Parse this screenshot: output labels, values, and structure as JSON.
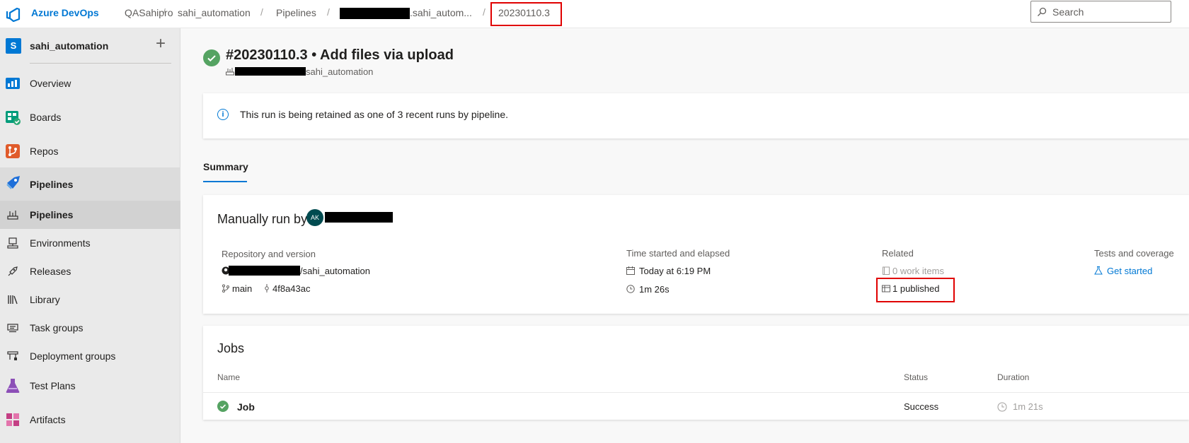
{
  "header": {
    "brand": "Azure DevOps",
    "breadcrumbs": [
      "QASahipro",
      "sahi_automation",
      "Pipelines",
      ".sahi_autom...",
      "20230110.3"
    ],
    "separator": "/",
    "search_placeholder": "Search"
  },
  "sidebar": {
    "project_initial": "S",
    "project_name": "sahi_automation",
    "add_label": "+",
    "items": [
      {
        "label": "Overview",
        "icon": "overview-icon"
      },
      {
        "label": "Boards",
        "icon": "boards-icon"
      },
      {
        "label": "Repos",
        "icon": "repos-icon"
      },
      {
        "label": "Pipelines",
        "icon": "pipelines-icon"
      },
      {
        "label": "Pipelines",
        "icon": "pipelines-sub-icon"
      },
      {
        "label": "Environments",
        "icon": "environments-icon"
      },
      {
        "label": "Releases",
        "icon": "releases-icon"
      },
      {
        "label": "Library",
        "icon": "library-icon"
      },
      {
        "label": "Task groups",
        "icon": "task-groups-icon"
      },
      {
        "label": "Deployment groups",
        "icon": "deployment-groups-icon"
      },
      {
        "label": "Test Plans",
        "icon": "test-plans-icon"
      },
      {
        "label": "Artifacts",
        "icon": "artifacts-icon"
      }
    ]
  },
  "run": {
    "title": "#20230110.3 • Add files via upload",
    "subtitle": "sahi_automation",
    "info_icon": "i",
    "retention_message": "This run is being retained as one of 3 recent runs by pipeline.",
    "tab": "Summary"
  },
  "summary": {
    "heading": "Manually run by",
    "avatar_initials": "AK",
    "repo_header": "Repository and version",
    "repo_name": "/sahi_automation",
    "branch": "main",
    "commit": "4f8a43ac",
    "time_header": "Time started and elapsed",
    "started": "Today at 6:19 PM",
    "elapsed": "1m 26s",
    "related_header": "Related",
    "work_items": "0 work items",
    "published": "1 published",
    "tests_header": "Tests and coverage",
    "tests_link": "Get started"
  },
  "jobs": {
    "heading": "Jobs",
    "columns": [
      "Name",
      "Status",
      "Duration"
    ],
    "rows": [
      {
        "name": "Job",
        "status": "Success",
        "duration": "1m 21s"
      }
    ]
  },
  "colors": {
    "accent": "#0078d4",
    "success": "#55a362",
    "highlight": "#e00000"
  }
}
